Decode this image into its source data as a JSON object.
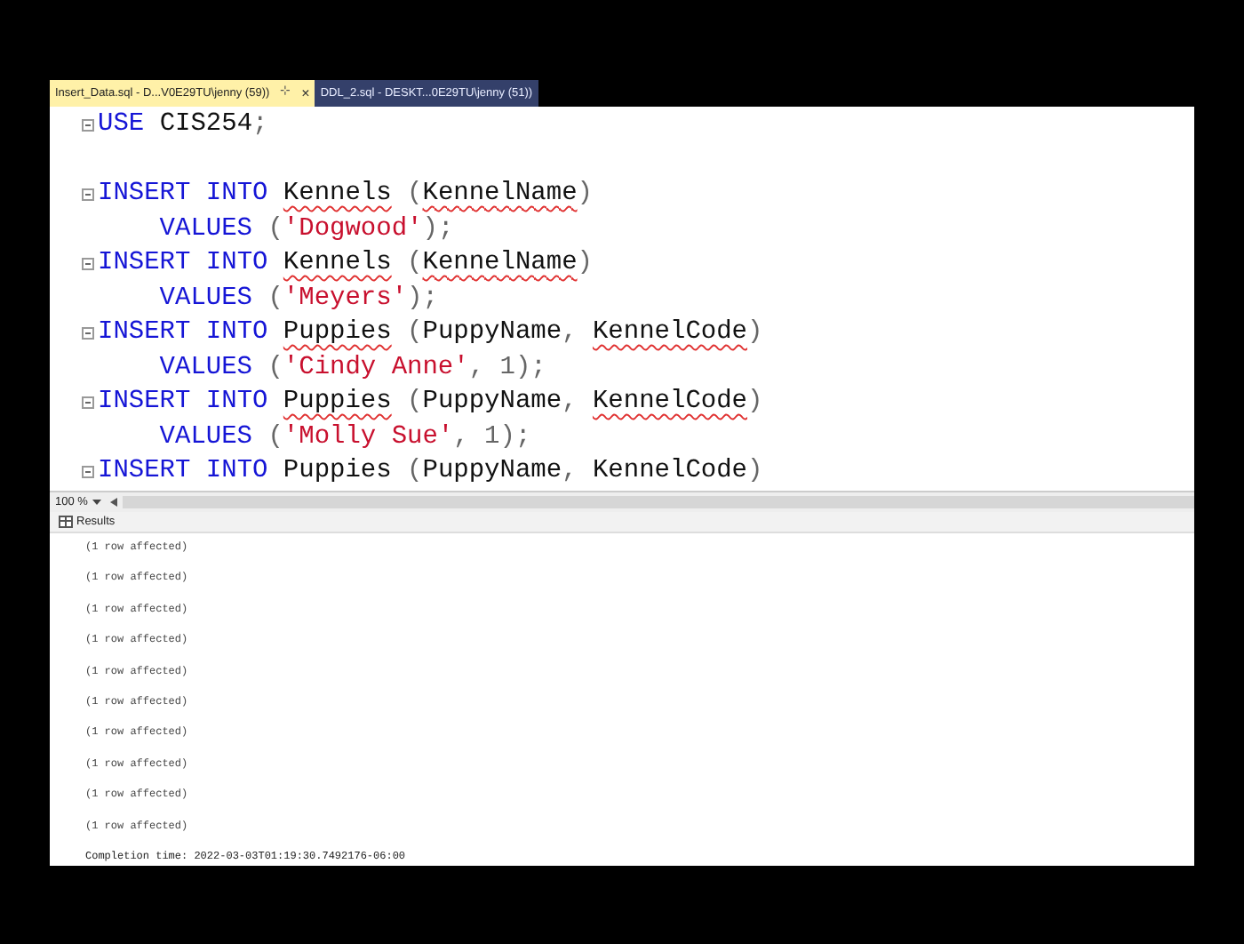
{
  "tabs": [
    {
      "label": "Insert_Data.sql - D...V0E29TU\\jenny (59))",
      "selected": true,
      "pin": "⊹",
      "close": "×"
    },
    {
      "label": "DDL_2.sql - DESKT...0E29TU\\jenny (51))",
      "selected": false
    }
  ],
  "editor": {
    "lines": [
      {
        "fold": true,
        "indent": false,
        "tokens": [
          {
            "kind": "keyword",
            "text": "USE "
          },
          {
            "kind": "plain",
            "text": "CIS254"
          },
          {
            "kind": "punct",
            "text": ";"
          }
        ]
      },
      {
        "fold": false
      },
      {
        "fold": true,
        "indent": false,
        "tokens": [
          {
            "kind": "keyword",
            "text": "INSERT INTO "
          },
          {
            "kind": "ident",
            "text": "Kennels",
            "squiggle": true
          },
          {
            "kind": "punct",
            "text": " ("
          },
          {
            "kind": "ident",
            "text": "KennelName",
            "squiggle": true
          },
          {
            "kind": "punct",
            "text": ")"
          }
        ]
      },
      {
        "fold": false,
        "indent": true,
        "tokens": [
          {
            "kind": "keyword",
            "text": "VALUES "
          },
          {
            "kind": "punct",
            "text": "("
          },
          {
            "kind": "string",
            "text": "'Dogwood'"
          },
          {
            "kind": "punct",
            "text": ");"
          }
        ]
      },
      {
        "fold": true,
        "indent": false,
        "tokens": [
          {
            "kind": "keyword",
            "text": "INSERT INTO "
          },
          {
            "kind": "ident",
            "text": "Kennels",
            "squiggle": true
          },
          {
            "kind": "punct",
            "text": " ("
          },
          {
            "kind": "ident",
            "text": "KennelName",
            "squiggle": true
          },
          {
            "kind": "punct",
            "text": ")"
          }
        ]
      },
      {
        "fold": false,
        "indent": true,
        "tokens": [
          {
            "kind": "keyword",
            "text": "VALUES "
          },
          {
            "kind": "punct",
            "text": "("
          },
          {
            "kind": "string",
            "text": "'Meyers'"
          },
          {
            "kind": "punct",
            "text": ");"
          }
        ]
      },
      {
        "fold": true,
        "indent": false,
        "tokens": [
          {
            "kind": "keyword",
            "text": "INSERT INTO "
          },
          {
            "kind": "ident",
            "text": "Puppies",
            "squiggle": true
          },
          {
            "kind": "punct",
            "text": " ("
          },
          {
            "kind": "ident",
            "text": "PuppyName",
            "squiggle": false
          },
          {
            "kind": "punct",
            "text": ", "
          },
          {
            "kind": "ident",
            "text": "KennelCode",
            "squiggle": true
          },
          {
            "kind": "punct",
            "text": ")"
          }
        ]
      },
      {
        "fold": false,
        "indent": true,
        "tokens": [
          {
            "kind": "keyword",
            "text": "VALUES "
          },
          {
            "kind": "punct",
            "text": "("
          },
          {
            "kind": "string",
            "text": "'Cindy Anne'"
          },
          {
            "kind": "punct",
            "text": ", 1);"
          }
        ]
      },
      {
        "fold": true,
        "indent": false,
        "tokens": [
          {
            "kind": "keyword",
            "text": "INSERT INTO "
          },
          {
            "kind": "ident",
            "text": "Puppies",
            "squiggle": true
          },
          {
            "kind": "punct",
            "text": " ("
          },
          {
            "kind": "ident",
            "text": "PuppyName",
            "squiggle": false
          },
          {
            "kind": "punct",
            "text": ", "
          },
          {
            "kind": "ident",
            "text": "KennelCode",
            "squiggle": true
          },
          {
            "kind": "punct",
            "text": ")"
          }
        ]
      },
      {
        "fold": false,
        "indent": true,
        "tokens": [
          {
            "kind": "keyword",
            "text": "VALUES "
          },
          {
            "kind": "punct",
            "text": "("
          },
          {
            "kind": "string",
            "text": "'Molly Sue'"
          },
          {
            "kind": "punct",
            "text": ", 1);"
          }
        ]
      },
      {
        "fold": true,
        "indent": false,
        "tokens": [
          {
            "kind": "keyword",
            "text": "INSERT INTO "
          },
          {
            "kind": "ident",
            "text": "Puppies",
            "squiggle": false
          },
          {
            "kind": "punct",
            "text": " ("
          },
          {
            "kind": "ident",
            "text": "PuppyName",
            "squiggle": false
          },
          {
            "kind": "punct",
            "text": ", "
          },
          {
            "kind": "ident",
            "text": "KennelCode",
            "squiggle": false
          },
          {
            "kind": "punct",
            "text": ")"
          }
        ]
      }
    ]
  },
  "zoom": {
    "value": "100 %"
  },
  "results": {
    "tab": "Results",
    "messages": [
      "(1 row affected)",
      "(1 row affected)",
      "(1 row affected)",
      "(1 row affected)",
      "(1 row affected)",
      "(1 row affected)",
      "(1 row affected)",
      "(1 row affected)",
      "(1 row affected)",
      "(1 row affected)"
    ],
    "completion": "Completion time: 2022-03-03T01:19:30.7492176-06:00"
  }
}
